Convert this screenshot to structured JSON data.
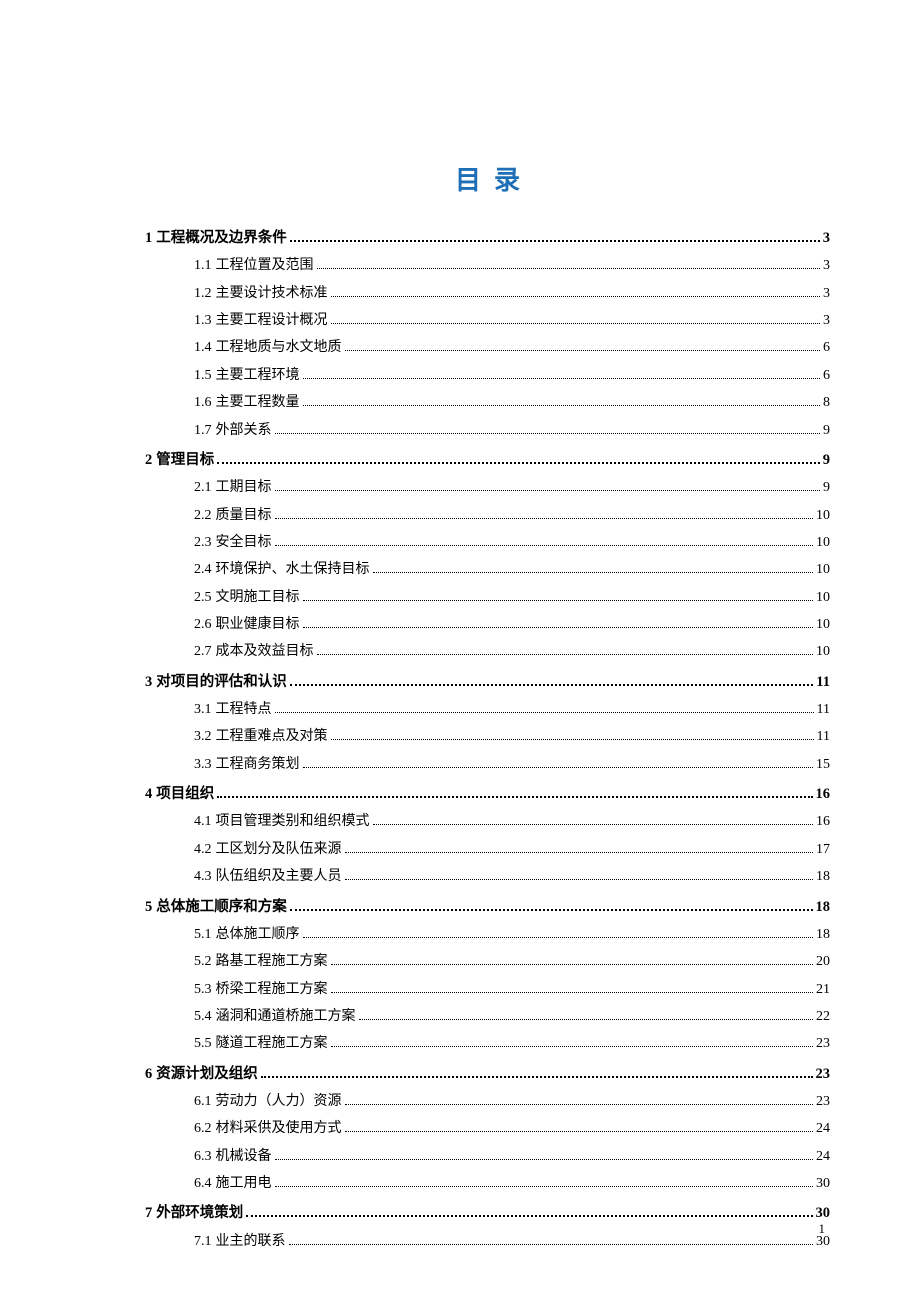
{
  "title_chars": [
    "目",
    "录"
  ],
  "page_number": "1",
  "toc": [
    {
      "level": 1,
      "num": "1",
      "label": "工程概况及边界条件",
      "page": "3"
    },
    {
      "level": 2,
      "num": "1.1",
      "label": "工程位置及范围",
      "page": "3"
    },
    {
      "level": 2,
      "num": "1.2",
      "label": "主要设计技术标准",
      "page": "3"
    },
    {
      "level": 2,
      "num": "1.3",
      "label": "主要工程设计概况",
      "page": "3"
    },
    {
      "level": 2,
      "num": "1.4",
      "label": "工程地质与水文地质",
      "page": "6"
    },
    {
      "level": 2,
      "num": "1.5",
      "label": "主要工程环境",
      "page": "6"
    },
    {
      "level": 2,
      "num": "1.6",
      "label": "主要工程数量",
      "page": "8"
    },
    {
      "level": 2,
      "num": "1.7",
      "label": "外部关系",
      "page": "9"
    },
    {
      "level": 1,
      "num": "2",
      "label": "管理目标",
      "page": "9"
    },
    {
      "level": 2,
      "num": "2.1",
      "label": "工期目标",
      "page": "9"
    },
    {
      "level": 2,
      "num": "2.2",
      "label": "质量目标",
      "page": "10"
    },
    {
      "level": 2,
      "num": "2.3",
      "label": "安全目标",
      "page": "10"
    },
    {
      "level": 2,
      "num": "2.4",
      "label": "环境保护、水土保持目标",
      "page": "10"
    },
    {
      "level": 2,
      "num": "2.5",
      "label": "文明施工目标",
      "page": "10"
    },
    {
      "level": 2,
      "num": "2.6",
      "label": "职业健康目标",
      "page": "10"
    },
    {
      "level": 2,
      "num": "2.7",
      "label": "成本及效益目标",
      "page": "10"
    },
    {
      "level": 1,
      "num": "3",
      "label": "对项目的评估和认识",
      "page": "11"
    },
    {
      "level": 2,
      "num": "3.1",
      "label": "工程特点",
      "page": "11"
    },
    {
      "level": 2,
      "num": "3.2",
      "label": "工程重难点及对策",
      "page": "11"
    },
    {
      "level": 2,
      "num": "3.3",
      "label": "工程商务策划",
      "page": "15"
    },
    {
      "level": 1,
      "num": "4",
      "label": "项目组织",
      "page": "16"
    },
    {
      "level": 2,
      "num": "4.1",
      "label": "项目管理类别和组织模式",
      "page": "16"
    },
    {
      "level": 2,
      "num": "4.2",
      "label": "工区划分及队伍来源",
      "page": "17"
    },
    {
      "level": 2,
      "num": "4.3",
      "label": "队伍组织及主要人员",
      "page": "18"
    },
    {
      "level": 1,
      "num": "5",
      "label": "总体施工顺序和方案",
      "page": "18"
    },
    {
      "level": 2,
      "num": "5.1",
      "label": "总体施工顺序",
      "page": "18"
    },
    {
      "level": 2,
      "num": "5.2",
      "label": "路基工程施工方案",
      "page": "20"
    },
    {
      "level": 2,
      "num": "5.3",
      "label": "桥梁工程施工方案",
      "page": "21"
    },
    {
      "level": 2,
      "num": "5.4",
      "label": "涵洞和通道桥施工方案",
      "page": "22"
    },
    {
      "level": 2,
      "num": "5.5",
      "label": "隧道工程施工方案",
      "page": "23"
    },
    {
      "level": 1,
      "num": "6",
      "label": "资源计划及组织",
      "page": "23"
    },
    {
      "level": 2,
      "num": "6.1",
      "label": "劳动力（人力）资源",
      "page": "23"
    },
    {
      "level": 2,
      "num": "6.2",
      "label": "材料采供及使用方式",
      "page": "24"
    },
    {
      "level": 2,
      "num": "6.3",
      "label": "机械设备",
      "page": "24"
    },
    {
      "level": 2,
      "num": "6.4",
      "label": "施工用电",
      "page": "30"
    },
    {
      "level": 1,
      "num": "7",
      "label": "外部环境策划",
      "page": "30"
    },
    {
      "level": 2,
      "num": "7.1",
      "label": "业主的联系",
      "page": "30"
    }
  ]
}
